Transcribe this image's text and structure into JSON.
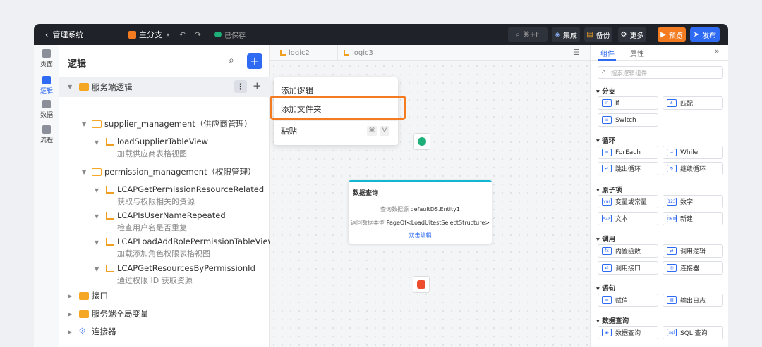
{
  "topbar": {
    "back_label": "管理系统",
    "branch": "主分支",
    "saved": "已保存",
    "search_hint": "⌘+F",
    "integrate": "集成",
    "backup": "备份",
    "more": "更多",
    "preview": "预览",
    "publish": "发布"
  },
  "leftnav": [
    {
      "label": "页面"
    },
    {
      "label": "逻辑"
    },
    {
      "label": "数据"
    },
    {
      "label": "流程"
    }
  ],
  "tree": {
    "title": "逻辑",
    "items": [
      {
        "label": "服务端逻辑"
      },
      {
        "label": "supplier_management（供应商管理）"
      },
      {
        "label": "loadSupplierTableView",
        "sub": "加载供应商表格视图"
      },
      {
        "label": "permission_management（权限管理）"
      },
      {
        "label": "LCAPGetPermissionResourceRelated",
        "sub": "获取与权限相关的资源"
      },
      {
        "label": "LCAPIsUserNameRepeated",
        "sub": "检查用户名是否重复"
      },
      {
        "label": "LCAPLoadAddRolePermissionTableView",
        "sub": "加载添加角色权限表格视图"
      },
      {
        "label": "LCAPGetResourcesByPermissionId",
        "sub": "通过权限 ID 获取资源"
      },
      {
        "label": "接口"
      },
      {
        "label": "服务端全局变量"
      },
      {
        "label": "连接器"
      }
    ]
  },
  "tabs": [
    {
      "label": "logic2"
    },
    {
      "label": "logic3"
    }
  ],
  "context_menu": {
    "add_logic": "添加逻辑",
    "add_folder": "添加文件夹",
    "paste": "粘贴",
    "paste_key1": "⌘",
    "paste_key2": "V"
  },
  "query_card": {
    "title": "数据查询",
    "source_label": "查询数据源",
    "source_value": "defaultDS.Entity1",
    "return_label": "返回数据类型",
    "return_value": "PageOf<LoadUitestSelectStructure>",
    "action": "双击编辑"
  },
  "right": {
    "tab_components": "组件",
    "tab_props": "属性",
    "search_placeholder": "搜索逻辑组件",
    "sections": {
      "branch": "分支",
      "loop": "循环",
      "atom": "原子项",
      "call": "调用",
      "statement": "语句",
      "dataquery": "数据查询"
    },
    "comps": {
      "if": "If",
      "match": "匹配",
      "switch": "Switch",
      "foreach": "ForEach",
      "while": "While",
      "break": "跳出循环",
      "continue": "继续循环",
      "var": "变量或常量",
      "number": "数字",
      "text": "文本",
      "new": "新建",
      "builtin": "内置函数",
      "calllogic": "调用逻辑",
      "callapi": "调用接口",
      "connector": "连接器",
      "assign": "赋值",
      "log": "输出日志",
      "query": "数据查询",
      "sql": "SQL 查询"
    }
  }
}
